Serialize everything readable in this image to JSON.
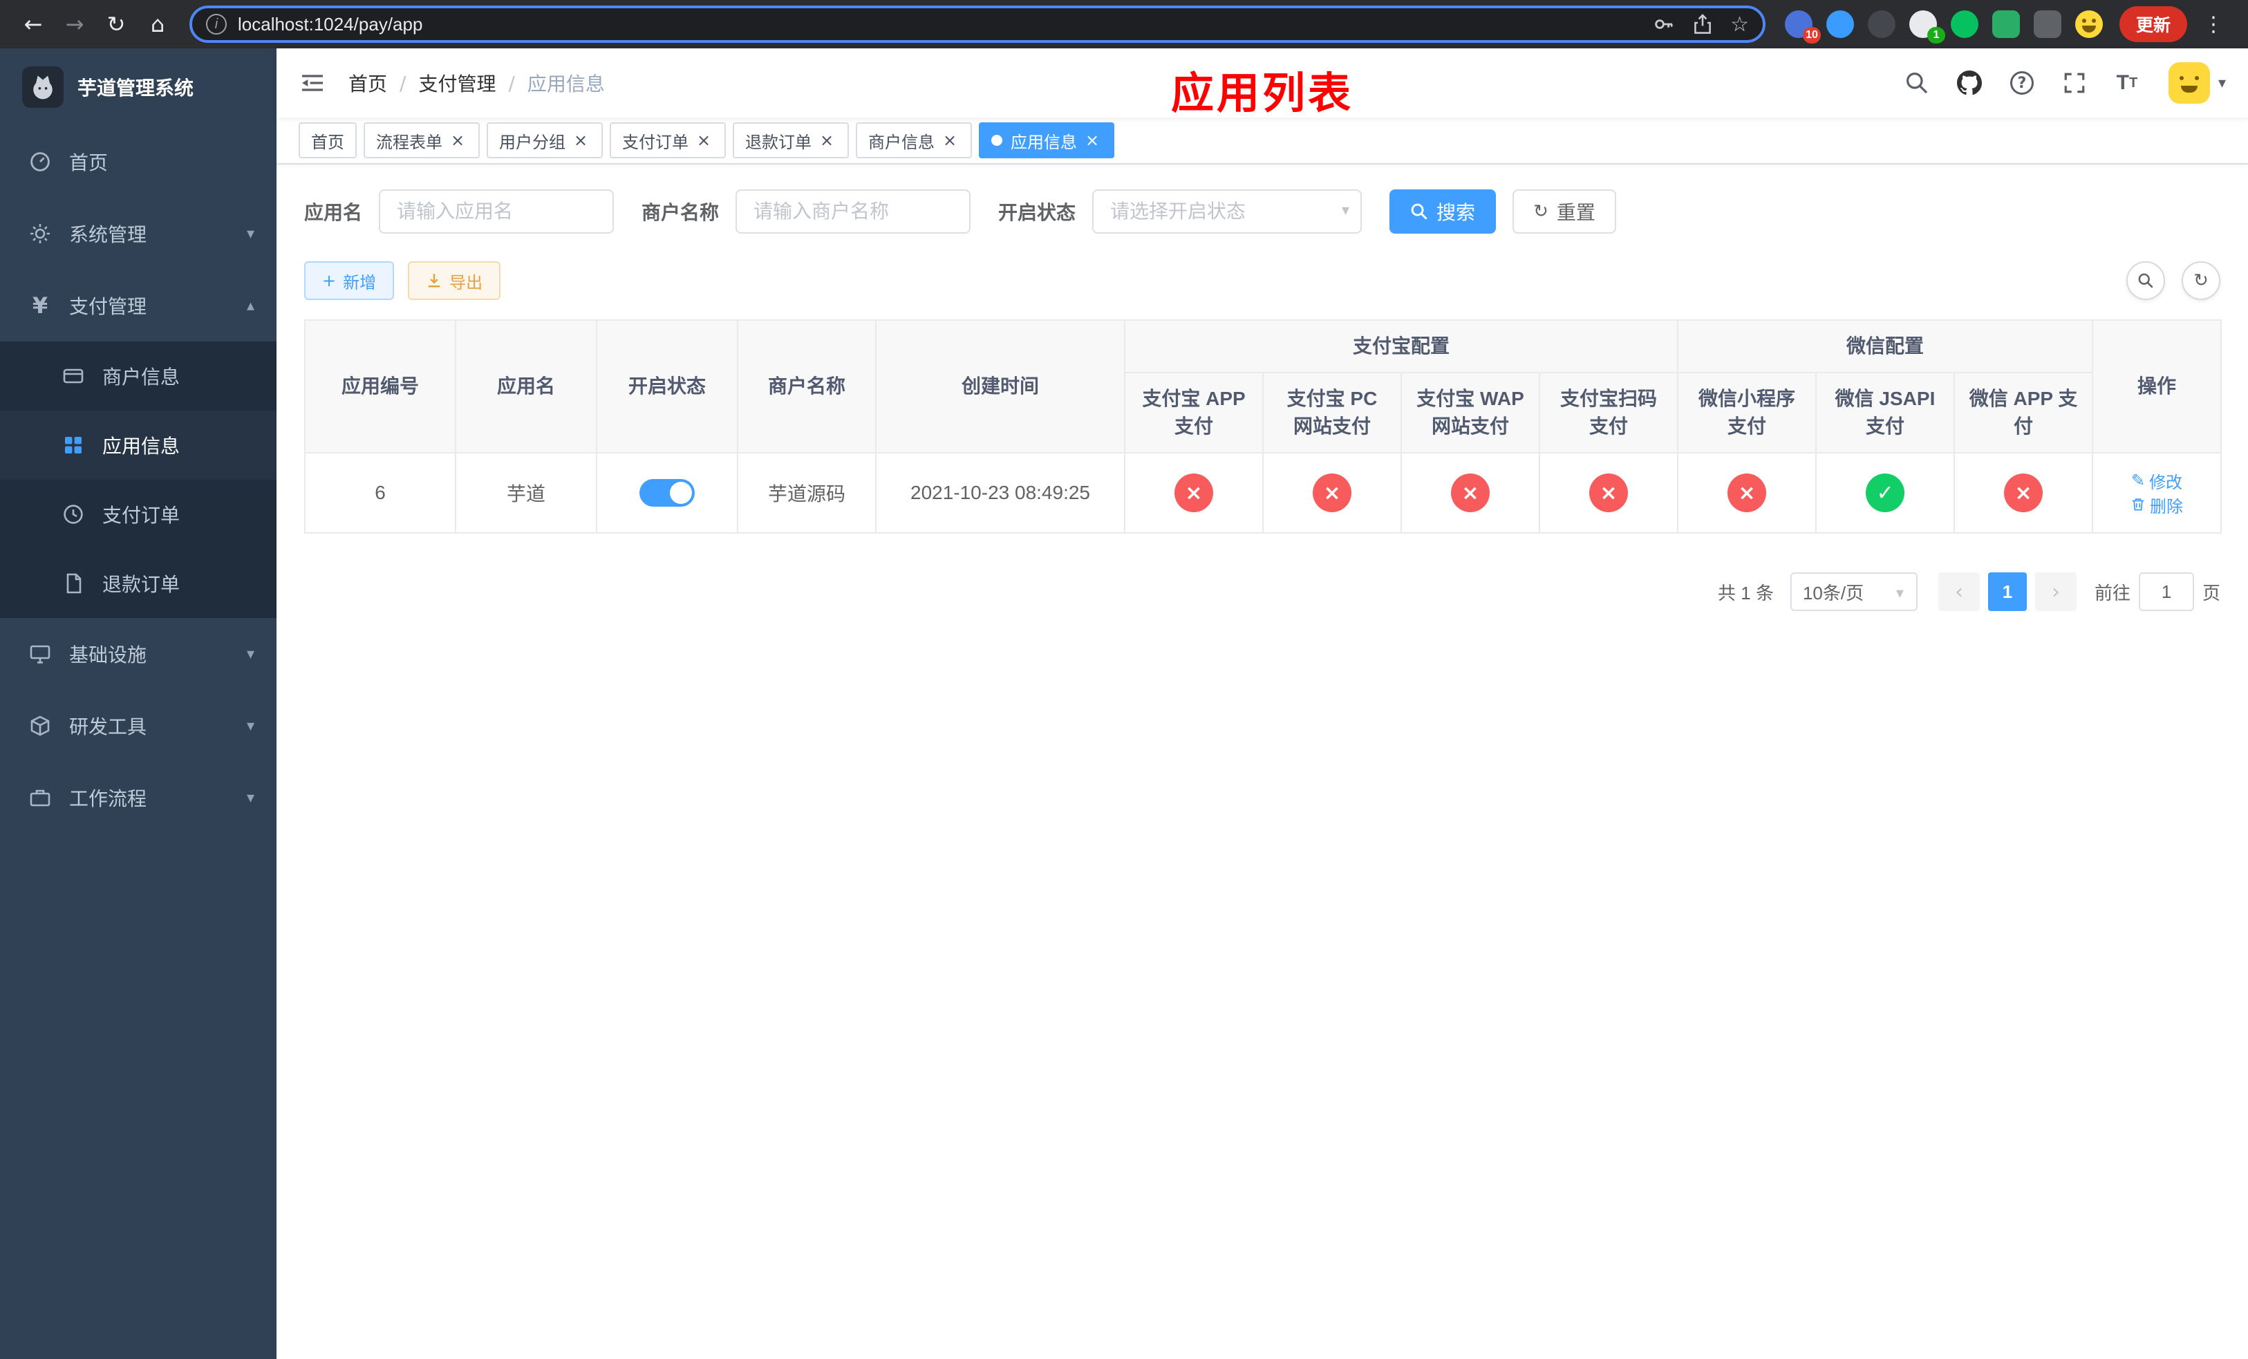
{
  "colors": {
    "primary": "#409eff",
    "success": "#13ce66",
    "danger": "#f85b5b",
    "warning": "#e6a23c",
    "overlay_red": "#ff0000"
  },
  "icons": {
    "close": "×",
    "caret_down": "▾",
    "caret_up": "▴",
    "dots": "⋮",
    "back": "←",
    "forward": "→",
    "refresh": "↻",
    "home": "⌂",
    "star": "☆",
    "info": "i",
    "plus": "+",
    "prev": "‹",
    "next": "›",
    "edit": "✎",
    "breadcrumb_sep": "/",
    "question": "?",
    "font_big": "T",
    "font_small": "T",
    "yen": "¥"
  },
  "browser": {
    "url": "localhost:1024/pay/app",
    "update_label": "更新",
    "ext_badge_first": "10",
    "ext_badge_second": "1"
  },
  "sidebar": {
    "title": "芋道管理系统",
    "home": "首页",
    "system": "系统管理",
    "pay": "支付管理",
    "pay_children": [
      "商户信息",
      "应用信息",
      "支付订单",
      "退款订单"
    ],
    "infra": "基础设施",
    "devtools": "研发工具",
    "workflow": "工作流程"
  },
  "navbar": {
    "breadcrumb": [
      "首页",
      "支付管理",
      "应用信息"
    ],
    "overlay_title": "应用列表"
  },
  "tabs": {
    "active_index": 6,
    "items": [
      {
        "label": "首页",
        "closable": false
      },
      {
        "label": "流程表单",
        "closable": true
      },
      {
        "label": "用户分组",
        "closable": true
      },
      {
        "label": "支付订单",
        "closable": true
      },
      {
        "label": "退款订单",
        "closable": true
      },
      {
        "label": "商户信息",
        "closable": true
      },
      {
        "label": "应用信息",
        "closable": true
      }
    ]
  },
  "filters": {
    "app_name_label": "应用名",
    "app_name_placeholder": "请输入应用名",
    "merchant_label": "商户名称",
    "merchant_placeholder": "请输入商户名称",
    "status_label": "开启状态",
    "status_placeholder": "请选择开启状态",
    "search_label": "搜索",
    "reset_label": "重置"
  },
  "toolbar": {
    "add_label": "新增",
    "export_label": "导出"
  },
  "table": {
    "glyphs": {
      "pass": "✓",
      "fail": "×"
    },
    "headers": {
      "app_id": "应用编号",
      "app_name": "应用名",
      "status": "开启状态",
      "merchant": "商户名称",
      "created": "创建时间",
      "alipay_group": "支付宝配置",
      "wechat_group": "微信配置",
      "alipay_app": "支付宝 APP 支付",
      "alipay_pc": "支付宝 PC 网站支付",
      "alipay_wap": "支付宝 WAP 网站支付",
      "alipay_qr": "支付宝扫码支付",
      "wx_mini": "微信小程序支付",
      "wx_jsapi": "微信 JSAPI 支付",
      "wx_app": "微信 APP 支付",
      "ops": "操作"
    },
    "rows": [
      {
        "app_id": "6",
        "app_name": "芋道",
        "status_on": true,
        "merchant": "芋道源码",
        "created": "2021-10-23 08:49:25",
        "configs": [
          false,
          false,
          false,
          false,
          false,
          true,
          false
        ],
        "edit_label": "修改",
        "delete_label": "删除"
      }
    ]
  },
  "pagination": {
    "total_text": "共 1 条",
    "page_size": "10条/页",
    "current_page": "1",
    "goto_label": "前往",
    "goto_value": "1",
    "page_suffix": "页"
  }
}
